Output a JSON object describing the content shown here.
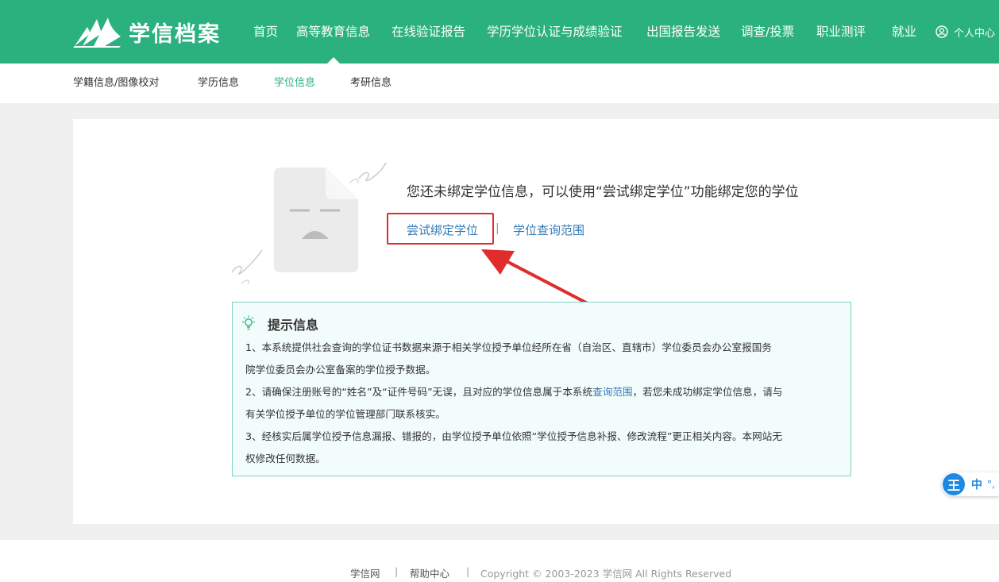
{
  "header": {
    "brand": "学信档案",
    "nav": [
      "首页",
      "高等教育信息",
      "在线验证报告",
      "学历学位认证与成绩验证",
      "出国报告发送",
      "调查/投票",
      "职业测评",
      "就业"
    ],
    "active_nav": "高等教育信息",
    "personal": "个人中心"
  },
  "subnav": {
    "items": [
      "学籍信息/图像校对",
      "学历信息",
      "学位信息",
      "考研信息"
    ],
    "active": "学位信息"
  },
  "main": {
    "message": "您还未绑定学位信息，可以使用“尝试绑定学位”功能绑定您的学位",
    "bind_link": "尝试绑定学位",
    "scope_link": "学位查询范围",
    "separator": "|"
  },
  "tips": {
    "title": "提示信息",
    "lines": [
      "1、本系统提供社会查询的学位证书数据来源于相关学位授予单位经所在省（自治区、直辖市）学位委员会办公室报国务",
      "院学位委员会办公室备案的学位授予数据。",
      "2、请确保注册账号的“姓名”及“证件号码”无误，且对应的学位信息属于本系统",
      "有关学位授予单位的学位管理部门联系核实。",
      "3、经核实后属学位授予信息漏报、错报的，由学位授予单位依照“学位授予信息补报、修改流程”更正相关内容。本网站无",
      "权修改任何数据。"
    ],
    "line3_link": "查询范围",
    "line3_tail": "，若您未成功绑定学位信息，请与"
  },
  "footer": {
    "site": "学信网",
    "help": "帮助中心",
    "sep": "|",
    "copyright": "Copyright © 2003-2023 学信网 All Rights Reserved"
  },
  "ime": {
    "logo": "王",
    "lang": "中",
    "punct": "°,"
  },
  "colors": {
    "brand_green": "#2ab17e",
    "link_blue": "#337ab7",
    "highlight_red": "#e02c2c",
    "tip_border": "#7fd3c6",
    "tip_bg": "#f2fcfb"
  }
}
